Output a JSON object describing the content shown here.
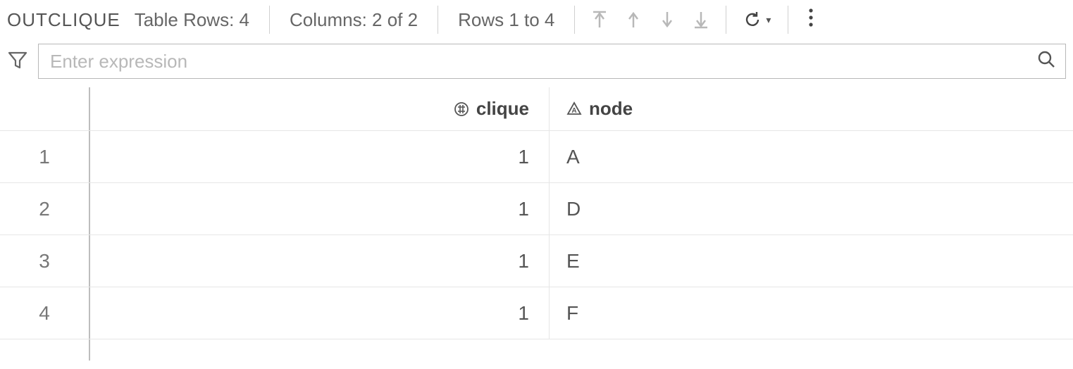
{
  "toolbar": {
    "title": "OUTCLIQUE",
    "rows_label": "Table Rows: 4",
    "columns_label": "Columns: 2 of 2",
    "range_label": "Rows 1 to 4"
  },
  "filter": {
    "placeholder": "Enter expression",
    "value": ""
  },
  "table": {
    "columns": [
      {
        "name": "clique",
        "type": "numeric"
      },
      {
        "name": "node",
        "type": "character"
      }
    ],
    "rows": [
      {
        "n": "1",
        "clique": "1",
        "node": "A"
      },
      {
        "n": "2",
        "clique": "1",
        "node": "D"
      },
      {
        "n": "3",
        "clique": "1",
        "node": "E"
      },
      {
        "n": "4",
        "clique": "1",
        "node": "F"
      }
    ]
  }
}
